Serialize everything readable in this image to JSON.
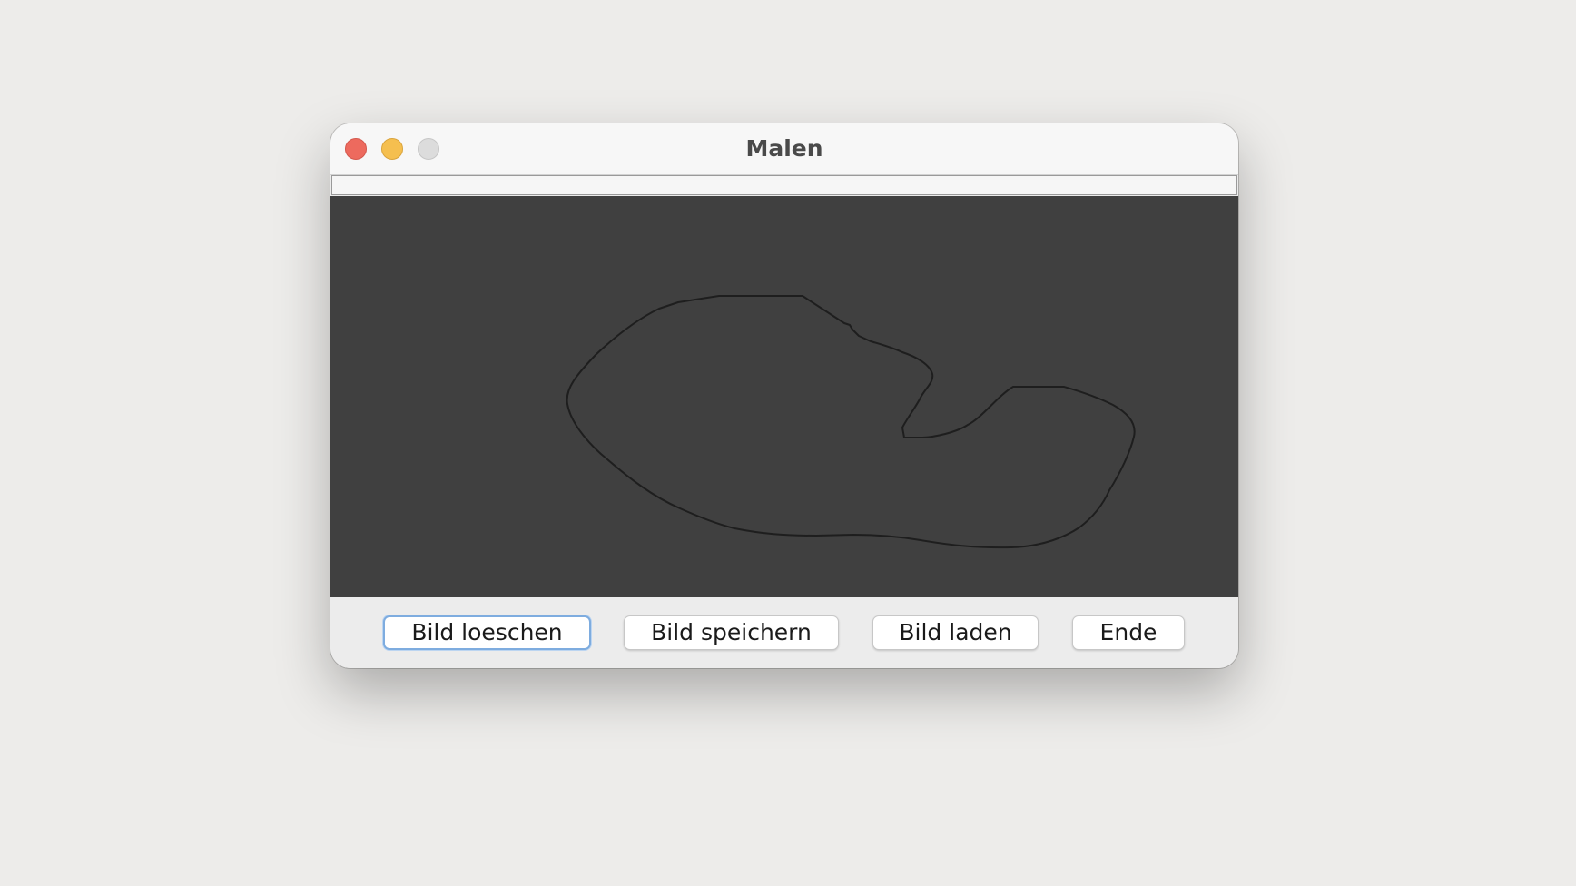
{
  "window": {
    "title": "Malen"
  },
  "buttons": {
    "clear_label": "Bild loeschen",
    "save_label": "Bild speichern",
    "load_label": "Bild laden",
    "exit_label": "Ende"
  },
  "colors": {
    "canvas_background": "#404040",
    "stroke": "#1e1e1e",
    "focus_ring": "#7eacdf",
    "close_light": "#ed6a5e",
    "minimize_light": "#f5bf4f",
    "zoom_light": "#dcdcdc"
  }
}
